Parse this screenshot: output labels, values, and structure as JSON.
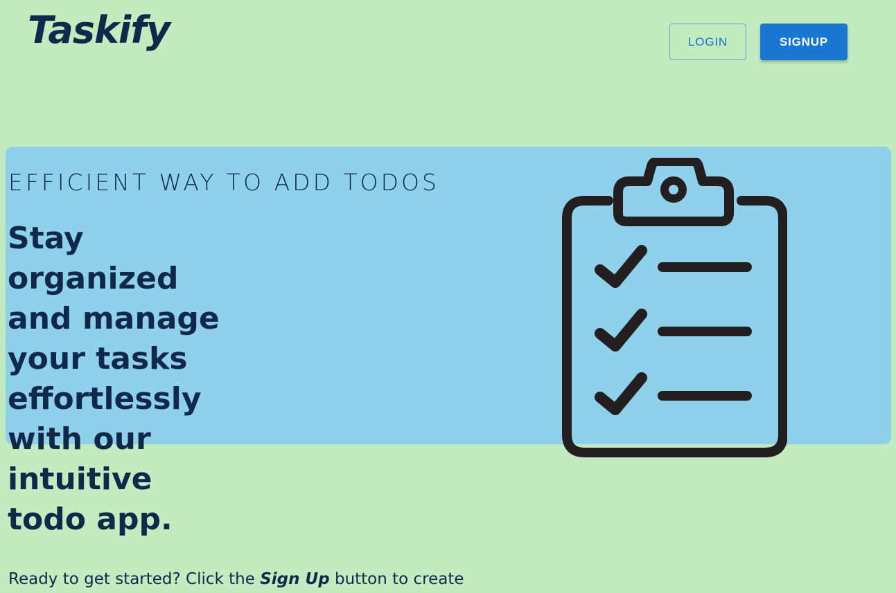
{
  "header": {
    "logo": "Taskify",
    "login_label": "LOGIN",
    "signup_label": "SIGNUP"
  },
  "hero": {
    "eyebrow": "EFFICIENT WAY TO ADD TODOS",
    "headline": "Stay organized and manage your tasks effortlessly with our intuitive todo app.",
    "cta_prefix": "Ready to get started? Click the ",
    "cta_emphasis": "Sign Up",
    "cta_suffix": " button to create"
  },
  "illustration": {
    "icon": "clipboard-checklist-icon",
    "rows": 3
  },
  "colors": {
    "page_background": "#c2ecc0",
    "hero_band": "#8fd0ea",
    "text": "#10294a",
    "primary": "#1976d2"
  }
}
